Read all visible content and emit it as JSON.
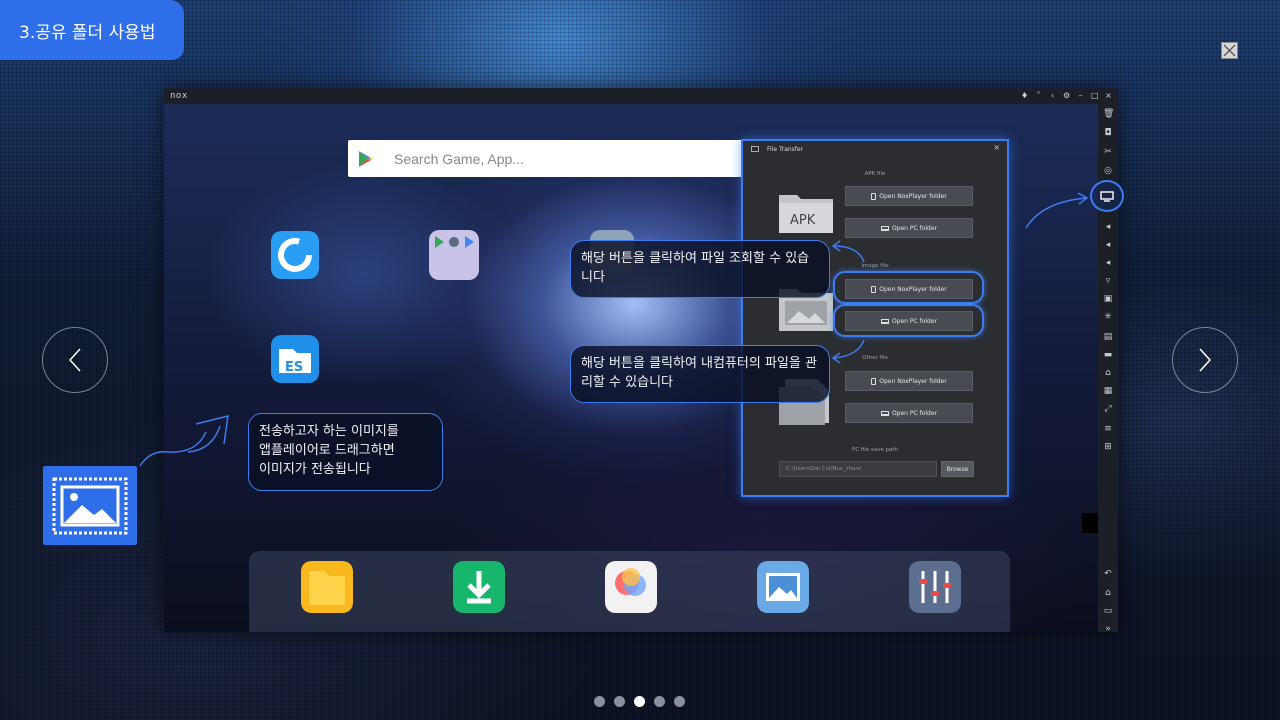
{
  "header": {
    "title": "3.공유 폴더 사용법"
  },
  "emulator": {
    "logo": "nox",
    "search_placeholder": "Search Game, App..."
  },
  "file_transfer": {
    "title": "File Transfer",
    "sections": [
      {
        "label": "APK file",
        "folder_label": "APK",
        "buttons": [
          "Open NoxPlayer folder",
          "Open PC folder"
        ]
      },
      {
        "label": "Image file",
        "buttons": [
          "Open NoxPlayer folder",
          "Open PC folder"
        ]
      },
      {
        "label": "Other file",
        "buttons": [
          "Open NoxPlayer folder",
          "Open PC folder"
        ]
      }
    ],
    "save_path_label": "PC file save path",
    "save_path_value": "C:\\Users\\Dai Cui\\Nox_share",
    "browse_label": "Browse"
  },
  "callouts": {
    "view_files": "해당 버튼을 클릭하여 파일 조회할 수 있습니다",
    "manage_files": "해당 버튼을 클릭하여 내컴퓨터의 파일을 관리할 수 있습니다",
    "drag_images": "전송하고자 하는 이미지를\n앱플레이어로 드래그하면\n이미지가 전송됩니다"
  },
  "pagination": {
    "total": 5,
    "current": 3
  },
  "colors": {
    "accent": "#2f6ee9",
    "highlight": "#3d7cf0"
  }
}
